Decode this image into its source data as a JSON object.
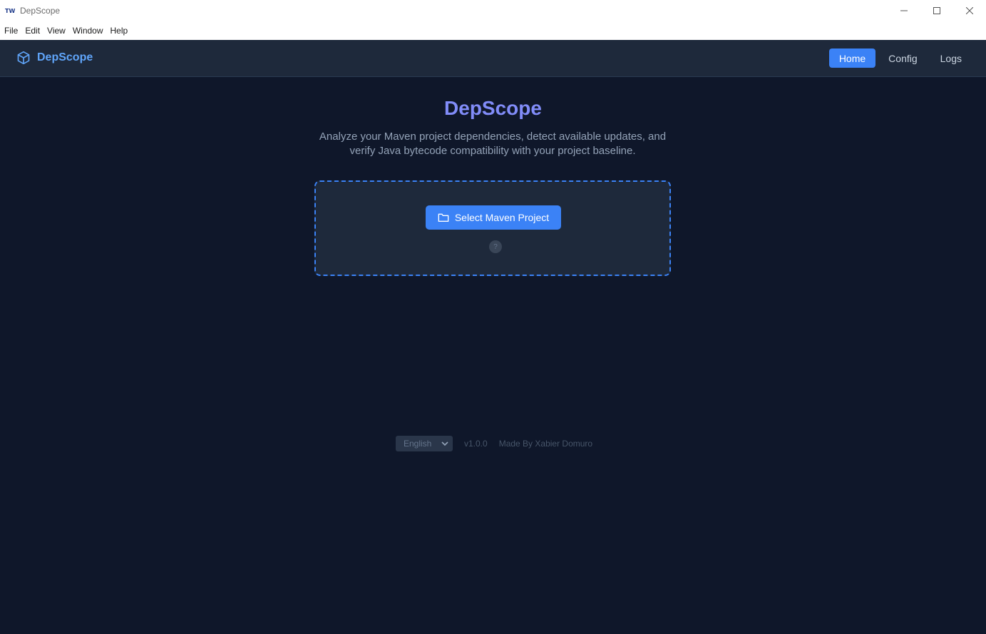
{
  "window": {
    "title": "DepScope",
    "menu": [
      "File",
      "Edit",
      "View",
      "Window",
      "Help"
    ]
  },
  "header": {
    "brand": "DepScope",
    "brand_icon": "cube-icon",
    "nav": [
      {
        "label": "Home",
        "active": true
      },
      {
        "label": "Config",
        "active": false
      },
      {
        "label": "Logs",
        "active": false
      }
    ]
  },
  "main": {
    "title": "DepScope",
    "subtitle": "Analyze your Maven project dependencies, detect available updates, and verify Java bytecode compatibility with your project baseline.",
    "select_button": "Select Maven Project",
    "help_label": "?"
  },
  "footer": {
    "language": "English",
    "version": "v1.0.0",
    "author": "Made By Xabier Domuro"
  },
  "colors": {
    "background": "#0f172a",
    "header": "#1e293b",
    "accent": "#3b82f6",
    "title": "#818cf8"
  }
}
